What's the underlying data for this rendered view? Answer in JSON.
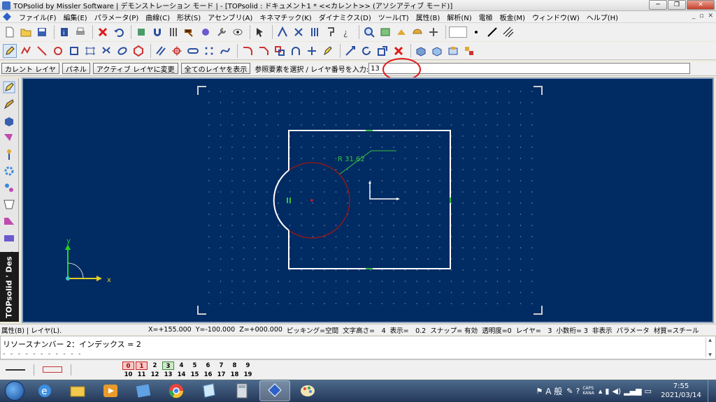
{
  "window": {
    "title": "TOPsolid by Missler Software | デモンストレーション モード | - [TOPsolid : ドキュメント1 *  <<カレント>> (アソシアティブ モード)]",
    "min_label": "─",
    "max_label": "❐",
    "close_label": "✕"
  },
  "menu": {
    "items": [
      "ファイル(F)",
      "編集(E)",
      "パラメータ(P)",
      "曲線(C)",
      "形状(S)",
      "アセンブリ(A)",
      "キネマチック(K)",
      "ダイナミクス(D)",
      "ツール(T)",
      "属性(B)",
      "解析(N)",
      "電極",
      "板金(M)",
      "ウィンドウ(W)",
      "ヘルプ(H)"
    ],
    "mdi_min": "_",
    "mdi_restore": "▫",
    "mdi_close": "✕"
  },
  "layerbar": {
    "current_layer_label": "カレント レイヤ",
    "panel_label": "パネル",
    "change_active_label": "アクティブ レイヤに変更",
    "show_all_label": "全てのレイヤを表示",
    "prompt": "参照要素を選択 / レイヤ番号を入力:",
    "input_value": "13"
  },
  "palette": {
    "brand": "TOPsolid ' Des"
  },
  "drawing": {
    "radius_label": "R 31.62",
    "axis_x": "x",
    "axis_y": "y"
  },
  "status": {
    "left": "属性(B) | レイヤ(L).",
    "fields": [
      "X=+155.000",
      "Y=-100.000",
      "Z=+000.000",
      "ピッキング=空間",
      "文字高さ=　4",
      "表示=　0.2",
      "スナップ= 有効",
      "透明度=0",
      "レイヤ=　3",
      "小数桁= 3",
      "非表示",
      "パラメータ",
      "材質=スチール"
    ]
  },
  "messages": {
    "line1": "リソースナンバー 2：インデックス = 2",
    "line2": "- - - - - - - - - - -"
  },
  "layers": {
    "top": [
      "0",
      "1",
      "2",
      "3",
      "4",
      "5",
      "6",
      "7",
      "8",
      "9"
    ],
    "bottom": [
      "10",
      "11",
      "12",
      "13",
      "14",
      "15",
      "16",
      "17",
      "18",
      "19"
    ]
  },
  "taskbar": {
    "ime": "A 般",
    "caps": "CAPS",
    "kana": "KANA",
    "time": "7:55",
    "date": "2021/03/14"
  },
  "colors": {
    "viewport_bg": "#002b63",
    "geometry": "#ffffff",
    "circle": "#8b1a1a",
    "dimension": "#3ec13e",
    "highlight": "#e01818",
    "axis_y": "#22d322",
    "axis_x": "#e2d020"
  }
}
